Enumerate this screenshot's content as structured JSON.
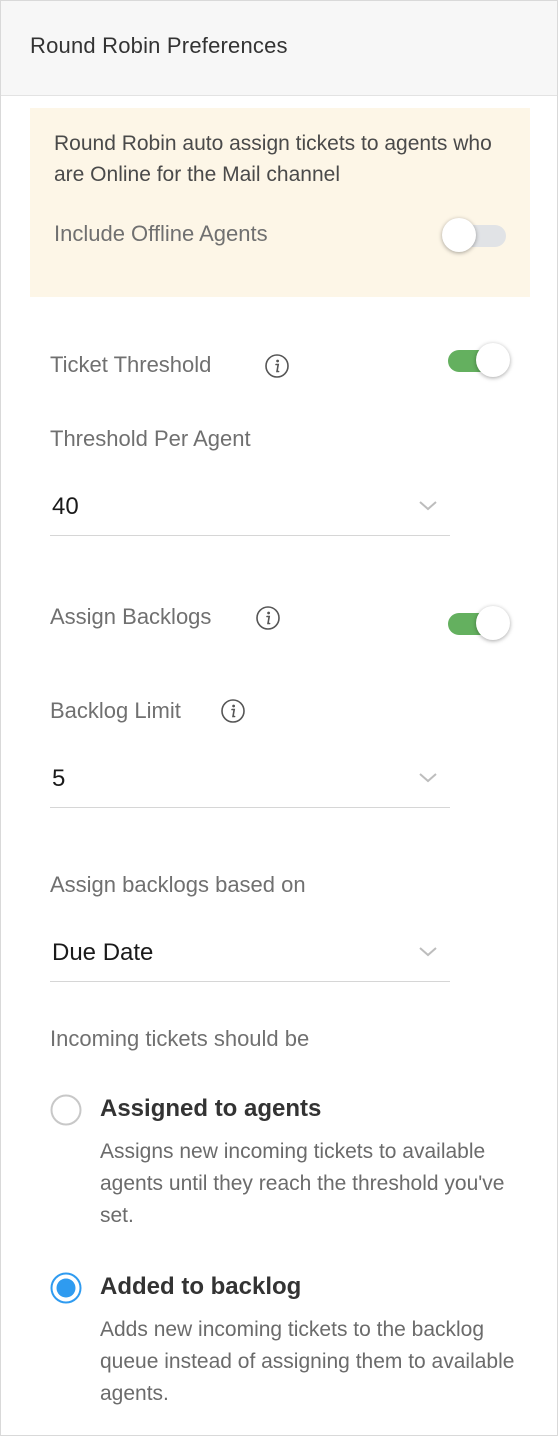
{
  "header": {
    "title": "Round Robin Preferences"
  },
  "notice": {
    "text": "Round Robin auto assign tickets to agents who are Online for the Mail channel",
    "offline_label": "Include Offline Agents",
    "offline_enabled": false
  },
  "ticket_threshold": {
    "label": "Ticket Threshold",
    "enabled": true,
    "per_agent_label": "Threshold Per Agent",
    "per_agent_value": "40"
  },
  "assign_backlogs": {
    "label": "Assign Backlogs",
    "enabled": true,
    "limit_label": "Backlog Limit",
    "limit_value": "5",
    "based_on_label": "Assign backlogs based on",
    "based_on_value": "Due Date"
  },
  "incoming": {
    "label": "Incoming tickets should be",
    "options": [
      {
        "title": "Assigned to agents",
        "description": "Assigns new incoming tickets to available agents until they reach the threshold you've set.",
        "selected": false
      },
      {
        "title": "Added to backlog",
        "description": "Adds new incoming tickets to the backlog queue instead of assigning them to available agents.",
        "selected": true
      }
    ]
  },
  "colors": {
    "toggle_on": "#64b05f",
    "radio_selected": "#2f9bf0",
    "notice_bg": "#fdf6e7"
  }
}
